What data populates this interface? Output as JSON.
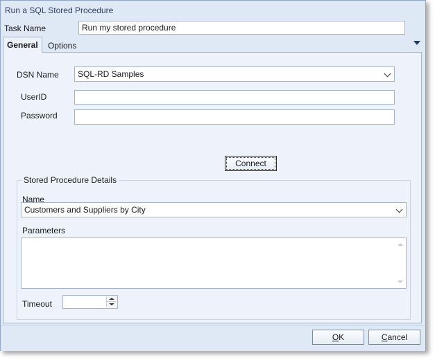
{
  "window": {
    "title": "Run a SQL Stored Procedure"
  },
  "task": {
    "label": "Task Name",
    "value": "Run my stored procedure"
  },
  "tabs": [
    {
      "label": "General",
      "active": true
    },
    {
      "label": "Options",
      "active": false
    }
  ],
  "general": {
    "dsn": {
      "label": "DSN Name",
      "value": "SQL-RD Samples"
    },
    "userid": {
      "label": "UserID",
      "value": ""
    },
    "password": {
      "label": "Password",
      "value": ""
    },
    "connect_label": "Connect",
    "sp": {
      "group_title": "Stored Procedure Details",
      "name_label": "Name",
      "name_value": "Customers and Suppliers by City",
      "parameters_label": "Parameters",
      "parameters_value": "",
      "timeout_label": "Timeout",
      "timeout_value": ""
    }
  },
  "footer": {
    "ok_mnemonic": "O",
    "ok_rest": "K",
    "cancel_mnemonic": "C",
    "cancel_rest": "ancel"
  },
  "icons": [
    "tab-menu-arrow-icon",
    "dropdown-chevron-icon",
    "scroll-up-icon",
    "scroll-down-icon",
    "spin-up-icon",
    "spin-down-icon"
  ],
  "colors": {
    "window_bg": "#dfe8f5",
    "panel_bg": "#eef3fb",
    "border": "#a7b4c6",
    "title_text": "#2c3e5c"
  }
}
